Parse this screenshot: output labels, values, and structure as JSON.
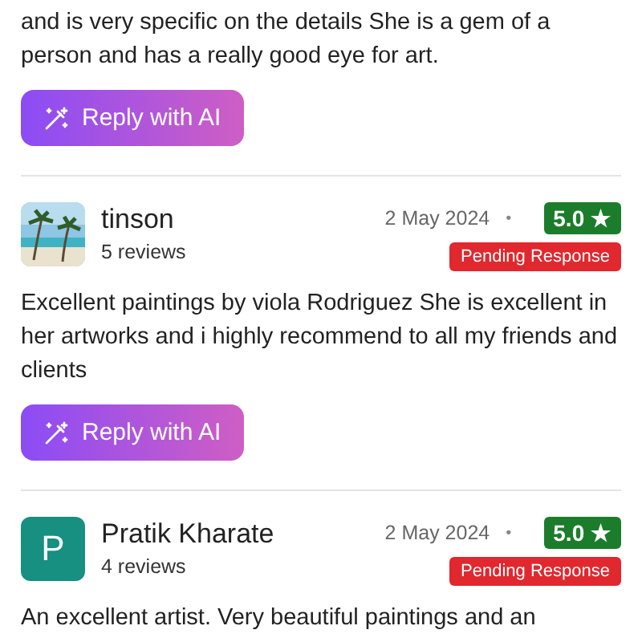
{
  "reviews": [
    {
      "text": "and is very specific on the details She is a gem of a person and has a really good eye for art.",
      "reply_button": "Reply with AI"
    },
    {
      "name": "tinson",
      "review_count": "5 reviews",
      "date": "2 May 2024",
      "separator": "•",
      "rating": "5.0 ★",
      "status": "Pending Response",
      "text": "Excellent paintings by viola Rodriguez She is excellent in her artworks and i highly recommend to all my friends and clients",
      "reply_button": "Reply with AI"
    },
    {
      "avatar": {
        "kind": "letter",
        "letter": "P",
        "color": "#178f81"
      },
      "name": "Pratik Kharate",
      "review_count": "4 reviews",
      "date": "2 May 2024",
      "separator": "•",
      "rating": "5.0 ★",
      "status": "Pending Response",
      "text": "An excellent artist. Very beautiful paintings and an"
    }
  ]
}
